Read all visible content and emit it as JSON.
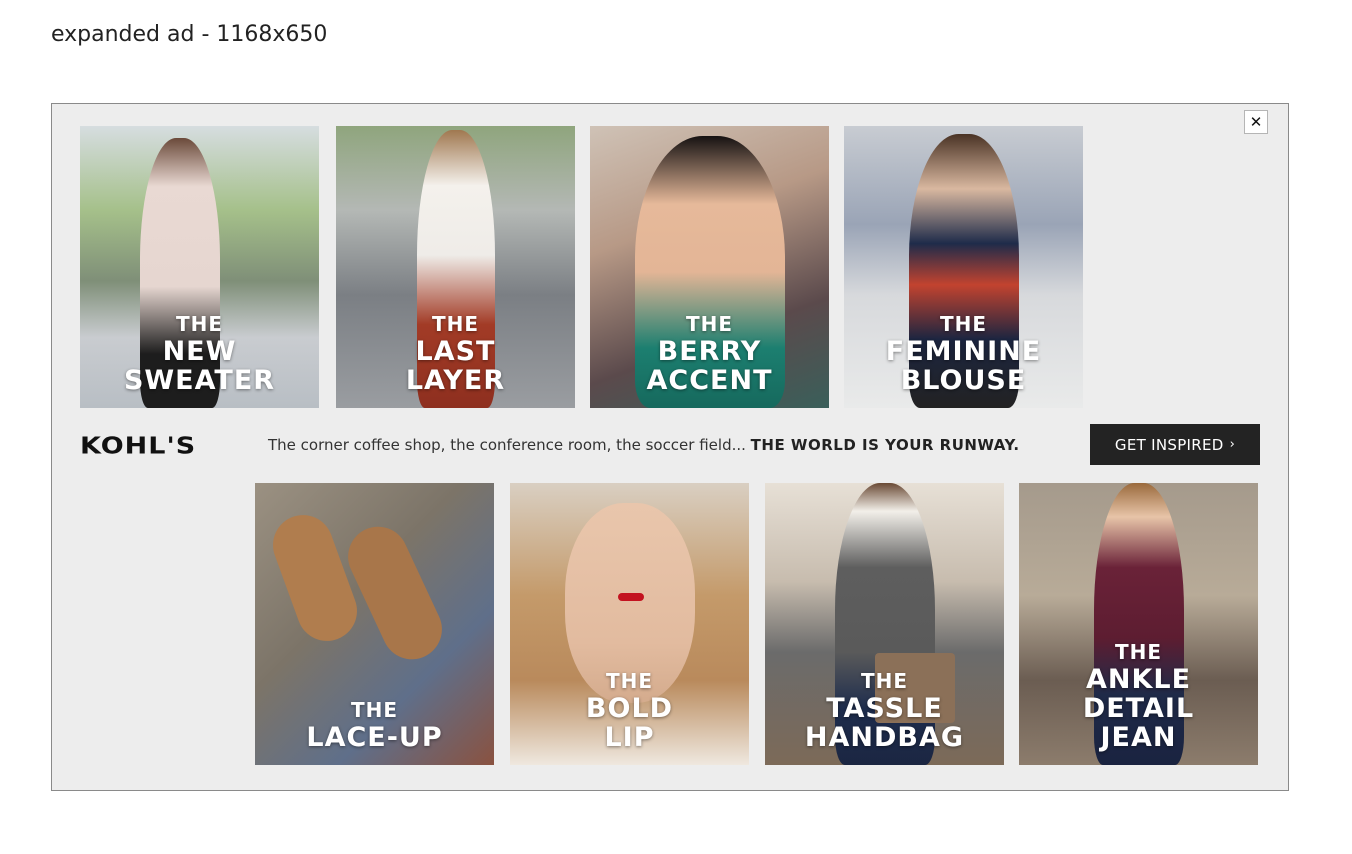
{
  "page_label": "expanded ad - 1168x650",
  "close_label": "✕",
  "brand": {
    "logo_text": "KOHL'S"
  },
  "tagline": {
    "text": "The corner coffee shop, the conference room, the soccer field...",
    "emphasis": "THE WORLD IS YOUR RUNWAY."
  },
  "cta": {
    "label": "GET INSPIRED",
    "chevron": "›"
  },
  "top_tiles": [
    {
      "the": "THE",
      "line1": "NEW",
      "line2": "SWEATER"
    },
    {
      "the": "THE",
      "line1": "LAST",
      "line2": "LAYER"
    },
    {
      "the": "THE",
      "line1": "BERRY",
      "line2": "ACCENT"
    },
    {
      "the": "THE",
      "line1": "FEMININE",
      "line2": "BLOUSE"
    }
  ],
  "bottom_tiles": [
    {
      "the": "THE",
      "line1": "LACE-UP"
    },
    {
      "the": "THE",
      "line1": "BOLD",
      "line2": "LIP"
    },
    {
      "the": "THE",
      "line1": "TASSLE",
      "line2": "HANDBAG"
    },
    {
      "the": "THE",
      "line1": "ANKLE",
      "line2": "DETAIL",
      "line3": "JEAN"
    }
  ]
}
